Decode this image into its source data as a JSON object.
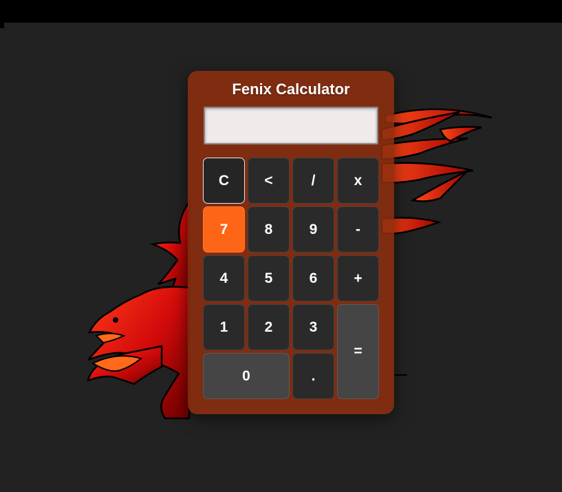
{
  "calculator": {
    "title": "Fenix Calculator",
    "display_value": "",
    "buttons": {
      "clear": "C",
      "backspace": "<",
      "divide": "/",
      "multiply": "x",
      "seven": "7",
      "eight": "8",
      "nine": "9",
      "subtract": "-",
      "four": "4",
      "five": "5",
      "six": "6",
      "add": "+",
      "one": "1",
      "two": "2",
      "three": "3",
      "equals": "=",
      "zero": "0",
      "decimal": "."
    }
  },
  "colors": {
    "background": "#222222",
    "panel": "#8c2d0f",
    "button": "#2b2a2a",
    "button_gray": "#464545",
    "accent": "#ff6516",
    "display": "#f0eaea"
  },
  "icons": {
    "background_art": "phoenix-icon"
  }
}
